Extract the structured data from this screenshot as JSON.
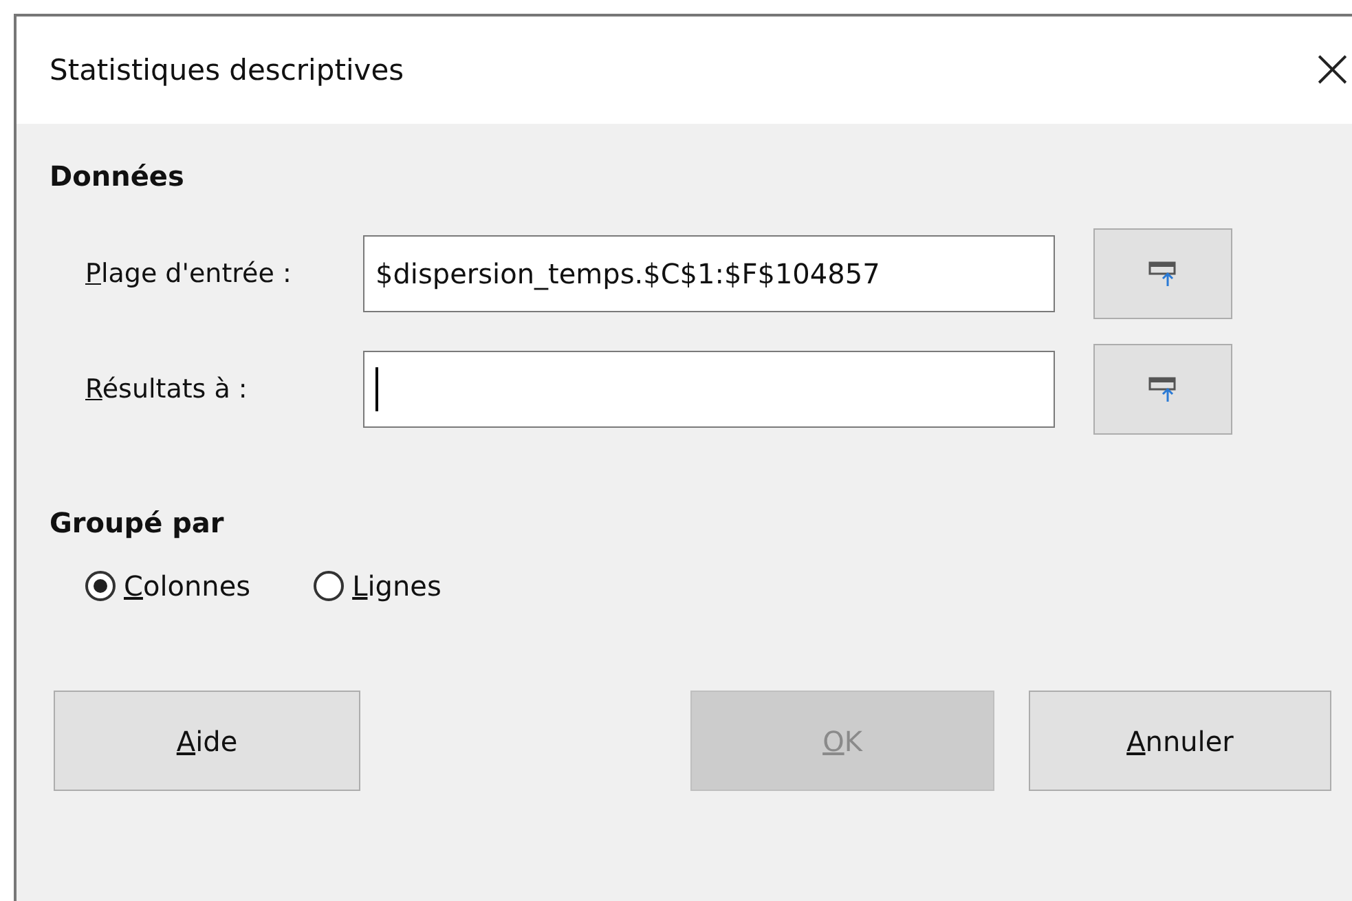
{
  "window": {
    "title": "Statistiques descriptives",
    "close": "×"
  },
  "data_section": {
    "heading": "Données",
    "fields": [
      {
        "label": "Plage d'entrée :",
        "value": "$dispersion_temps.$C$1:$F$104857",
        "focused": false
      },
      {
        "label": "Résultats à :",
        "focused": true
      }
    ]
  },
  "grouped_by": {
    "heading": "Groupé par",
    "options": [
      {
        "label": "Colonnes",
        "selected": true
      },
      {
        "label": "Lignes",
        "selected": false
      }
    ]
  },
  "buttons": [
    {
      "label": "Aide",
      "disabled": false
    },
    {
      "label": "OK",
      "disabled": true
    },
    {
      "label": "Annuler",
      "disabled": false
    }
  ]
}
